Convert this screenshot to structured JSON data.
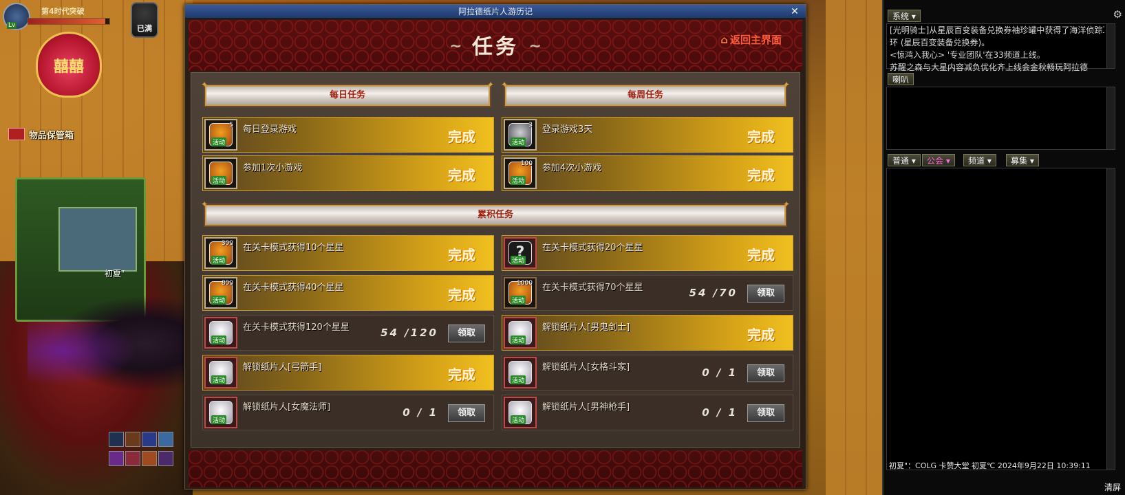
{
  "hud": {
    "player_name": "第4时代突破",
    "fatigue_label": "已满",
    "storage_label": "物品保管箱",
    "player_tag": "初夏\"",
    "heart_text": "囍囍"
  },
  "dialog": {
    "window_title": "阿拉德纸片人游历记",
    "close_symbol": "✕",
    "title": "任务",
    "title_left_ornament": "~",
    "title_right_ornament": "~",
    "return_label": "返回主界面",
    "return_icon": "⌂"
  },
  "sections": {
    "daily": "每日任务",
    "weekly": "每周任务",
    "cumulative": "累积任务"
  },
  "daily_tasks": [
    {
      "name": "每日登录游戏",
      "status": "完成",
      "qty": "5",
      "tag": "活动",
      "icon": "gold-medal-icon"
    },
    {
      "name": "参加1次小游戏",
      "status": "完成",
      "qty": "",
      "tag": "活动",
      "icon": "gift-box-icon"
    }
  ],
  "weekly_tasks": [
    {
      "name": "登录游戏3天",
      "status": "完成",
      "qty": "3",
      "tag": "活动",
      "icon": "sword-icon"
    },
    {
      "name": "参加4次小游戏",
      "status": "完成",
      "qty": "100",
      "tag": "活动",
      "icon": "gold-medal-icon"
    }
  ],
  "cumulative_left": [
    {
      "name": "在关卡模式获得10个星星",
      "status": "完成",
      "qty": "300",
      "tag": "活动",
      "icon": "gold-medal-icon"
    },
    {
      "name": "在关卡模式获得40个星星",
      "status": "完成",
      "qty": "800",
      "tag": "活动",
      "icon": "gold-medal-icon"
    },
    {
      "name": "在关卡模式获得120个星星",
      "status": "",
      "progress": "54 /120",
      "claim": "领取",
      "qty": "",
      "tag": "活动",
      "icon": "character-card-icon"
    },
    {
      "name": "解锁纸片人[弓箭手]",
      "status": "完成",
      "qty": "",
      "tag": "活动",
      "icon": "paper-doll-icon"
    },
    {
      "name": "解锁纸片人[女魔法师]",
      "status": "",
      "progress": "0 / 1",
      "claim": "领取",
      "qty": "",
      "tag": "活动",
      "icon": "paper-doll-icon"
    }
  ],
  "cumulative_right": [
    {
      "name": "在关卡模式获得20个星星",
      "status": "完成",
      "qty": "",
      "tag": "活动",
      "icon": "mystery-icon"
    },
    {
      "name": "在关卡模式获得70个星星",
      "status": "",
      "progress": "54 /70",
      "claim": "领取",
      "qty": "1000",
      "tag": "活动",
      "icon": "gold-medal-icon"
    },
    {
      "name": "解锁纸片人[男鬼剑士]",
      "status": "完成",
      "qty": "",
      "tag": "活动",
      "icon": "paper-doll-icon"
    },
    {
      "name": "解锁纸片人[女格斗家]",
      "status": "",
      "progress": "0 / 1",
      "claim": "领取",
      "qty": "",
      "tag": "活动",
      "icon": "paper-doll-icon"
    },
    {
      "name": "解锁纸片人[男神枪手]",
      "status": "",
      "progress": "0 / 1",
      "claim": "领取",
      "qty": "",
      "tag": "活动",
      "icon": "paper-doll-icon"
    }
  ],
  "chat": {
    "system_tab": "系统 ▾",
    "horn_tab": "喇叭",
    "tabs": [
      "普通 ▾",
      "公会 ▾",
      "频道 ▾",
      "募集 ▾"
    ],
    "system_lines": [
      "[光明骑士]从星辰百变装备兑换券袖珍罐中获得了海洋侦踪耳",
      "环 (星辰百变装备兑换券)。",
      "<惊鸿入我心> '专业团队'在33频道上线。",
      "苏醒之森与大星内容减负优化齐上线会金秋畅玩阿拉德"
    ],
    "status_line": "初夏\"：COLG   卡赞大堂   初夏℃   2024年9月22日 10:39:11",
    "clear_label": "清屏",
    "gear_icon": "⚙"
  },
  "colors": {
    "complete_gold": "#f0c020",
    "return_red": "#ff5a3a",
    "banner_text": "#a02010",
    "titlebar_blue": "#2a4a8a"
  }
}
